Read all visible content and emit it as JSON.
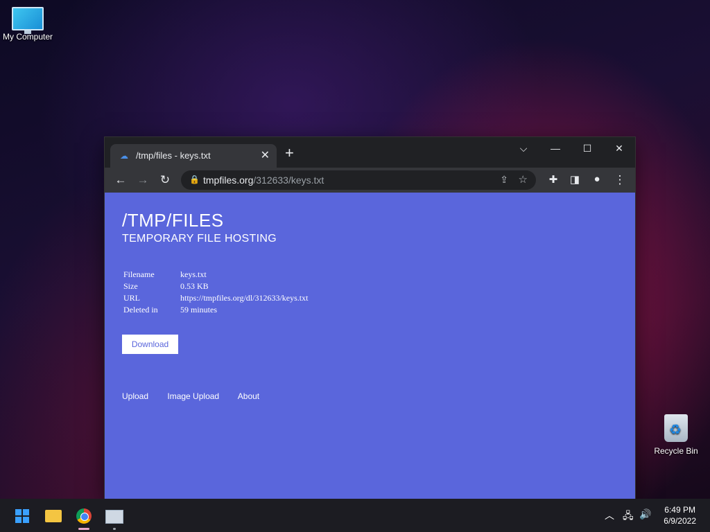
{
  "desktop": {
    "icons": [
      {
        "label": "My Computer",
        "icon": "computer-icon"
      },
      {
        "label": "Recycle Bin",
        "icon": "recycle-bin-icon"
      }
    ]
  },
  "browser": {
    "tab": {
      "title": "/tmp/files - keys.txt",
      "favicon": "cloud-icon",
      "close": "✕"
    },
    "new_tab": "+",
    "controls": {
      "dropdown": "⌵",
      "minimize": "—",
      "maximize": "☐",
      "close": "✕"
    },
    "toolbar": {
      "back": "←",
      "forward": "→",
      "reload": "↻",
      "extensions": "✚",
      "sidepanel": "◨",
      "profile": "●",
      "menu": "⋮"
    },
    "address": {
      "host": "tmpfiles.org",
      "path": "/312633/keys.txt",
      "lock": "🔒",
      "share": "⇪",
      "star": "☆"
    }
  },
  "page": {
    "title": "/TMP/FILES",
    "subtitle": "TEMPORARY FILE HOSTING",
    "info": [
      {
        "key": "Filename",
        "value": "keys.txt"
      },
      {
        "key": "Size",
        "value": "0.53 KB"
      },
      {
        "key": "URL",
        "value": "https://tmpfiles.org/dl/312633/keys.txt"
      },
      {
        "key": "Deleted in",
        "value": "59 minutes"
      }
    ],
    "download_label": "Download",
    "footer_links": [
      "Upload",
      "Image Upload",
      "About"
    ],
    "background_color": "#5a66dc"
  },
  "taskbar": {
    "apps": [
      "start-icon",
      "file-explorer-icon",
      "chrome-icon",
      "resource-monitor-icon"
    ],
    "tray": {
      "chevron": "︿",
      "network": "🖧",
      "volume": "🔊"
    },
    "time": "6:49 PM",
    "date": "6/9/2022"
  }
}
